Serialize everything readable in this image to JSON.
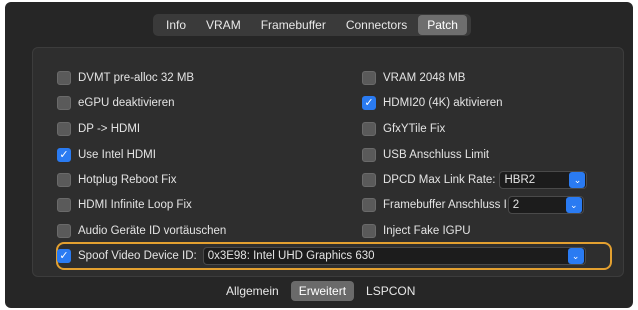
{
  "top_tabs": [
    "Info",
    "VRAM",
    "Framebuffer",
    "Connectors",
    "Patch"
  ],
  "active_top_tab": "Patch",
  "left_options": [
    {
      "label": "DVMT pre-alloc 32 MB",
      "checked": false
    },
    {
      "label": "eGPU deaktivieren",
      "checked": false
    },
    {
      "label": "DP -> HDMI",
      "checked": false
    },
    {
      "label": "Use Intel HDMI",
      "checked": true
    },
    {
      "label": "Hotplug Reboot Fix",
      "checked": false
    },
    {
      "label": "HDMI Infinite Loop Fix",
      "checked": false
    },
    {
      "label": "Audio Geräte ID vortäuschen",
      "checked": false
    }
  ],
  "right_options": [
    {
      "label": "VRAM 2048 MB",
      "checked": false
    },
    {
      "label": "HDMI20 (4K) aktivieren",
      "checked": true
    },
    {
      "label": "GfxYTile Fix",
      "checked": false
    },
    {
      "label": "USB Anschluss Limit",
      "checked": false
    },
    {
      "label": "DPCD Max Link Rate:",
      "checked": false,
      "select_value": "HBR2"
    },
    {
      "label": "Framebuffer Anschluss I",
      "checked": false,
      "select_value": "2"
    },
    {
      "label": "Inject Fake IGPU",
      "checked": false
    }
  ],
  "spoof": {
    "label": "Spoof Video Device ID:",
    "checked": true,
    "select_value": "0x3E98: Intel UHD Graphics 630"
  },
  "bottom_tabs": [
    "Allgemein",
    "Erweitert",
    "LSPCON"
  ],
  "active_bottom_tab": "Erweitert",
  "colors": {
    "accent": "#2a7bf2",
    "highlight": "#e3a030"
  }
}
